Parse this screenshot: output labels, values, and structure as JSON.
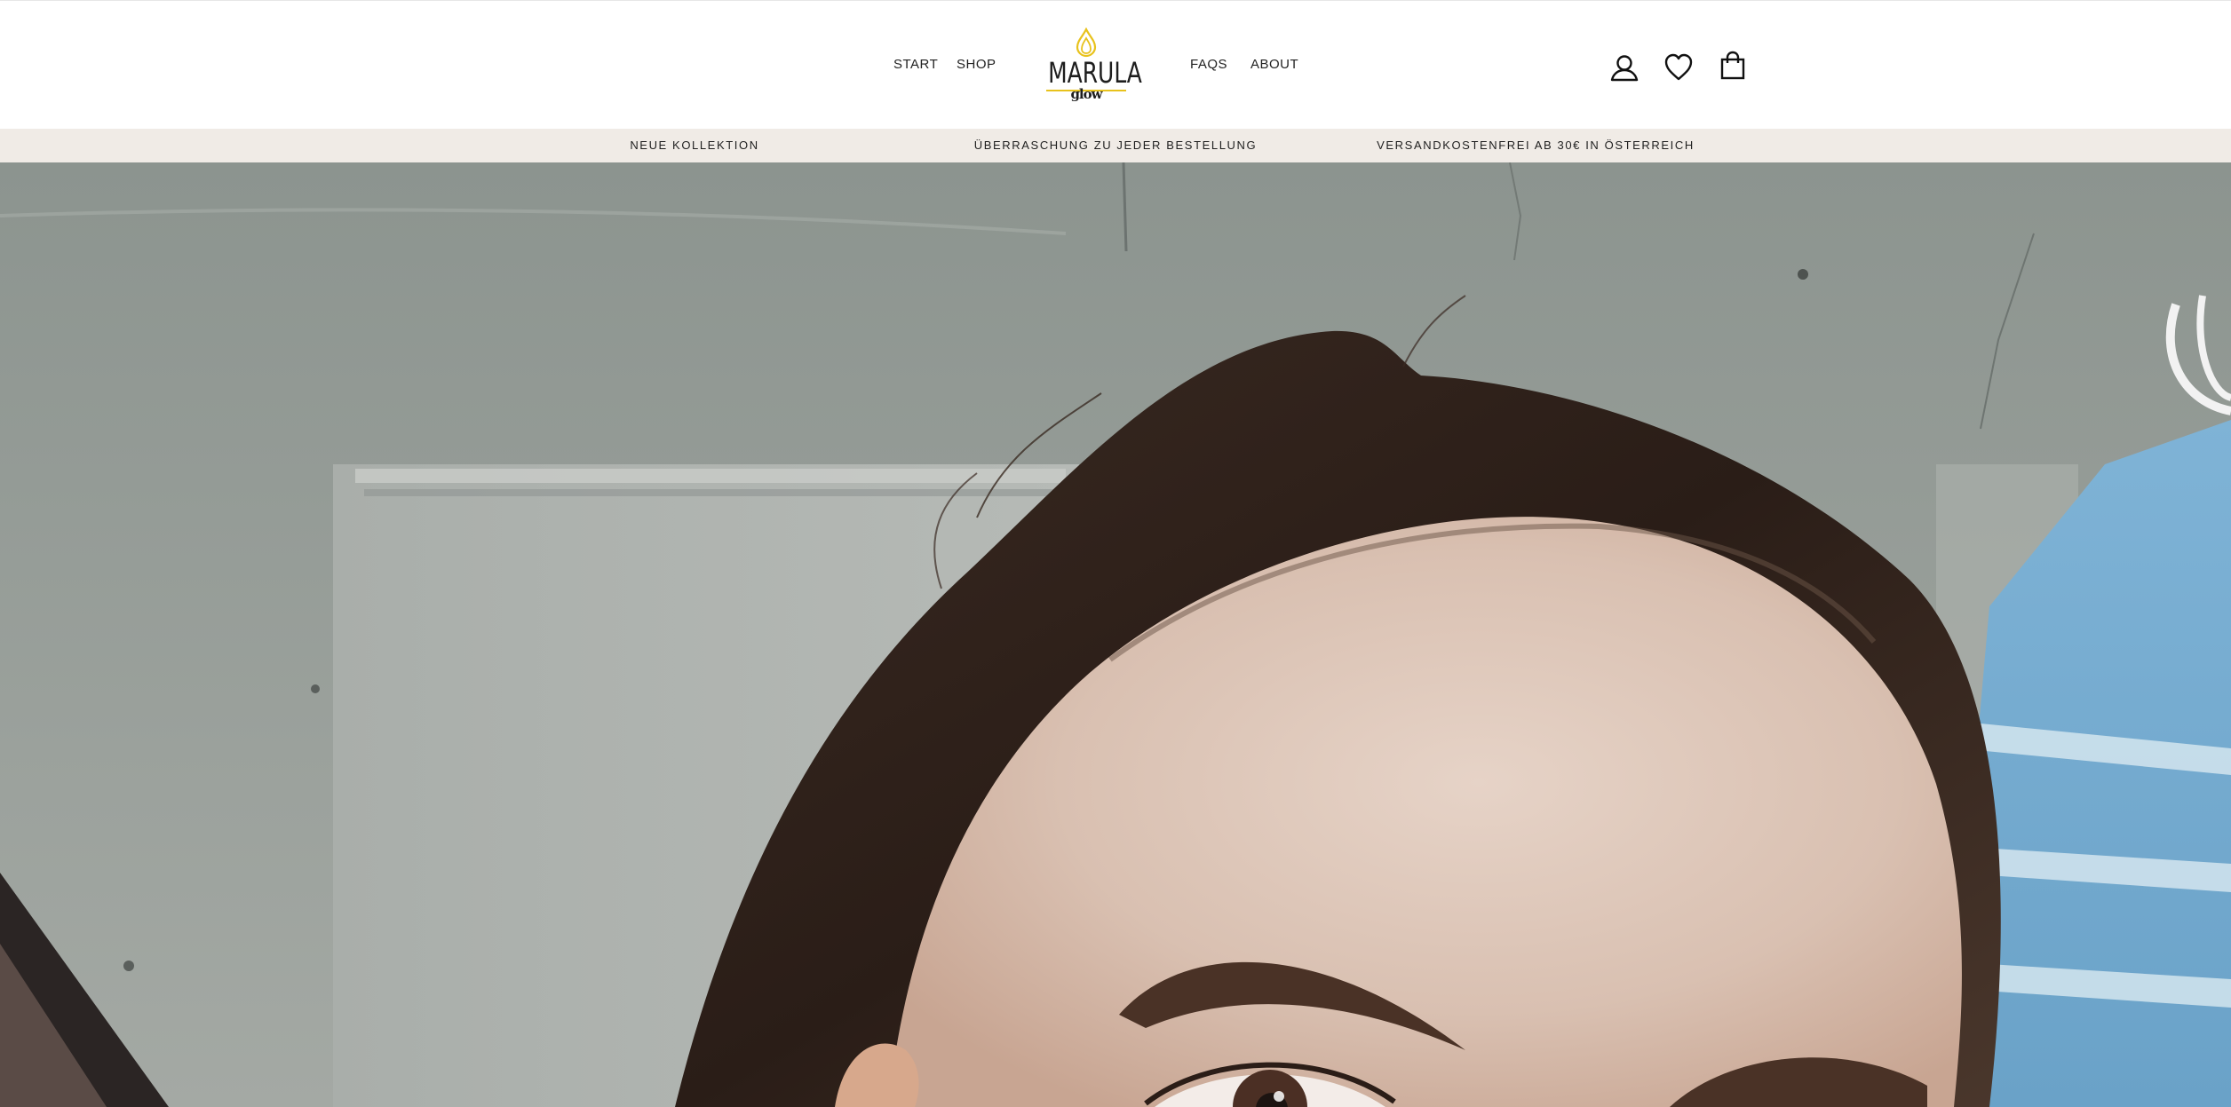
{
  "header": {
    "nav_left": [
      {
        "label": "START"
      },
      {
        "label": "SHOP"
      }
    ],
    "nav_right": [
      {
        "label": "FAQS"
      },
      {
        "label": "ABOUT"
      }
    ],
    "logo": {
      "wordmark": "MARULA",
      "subtext": "glow",
      "accent_color": "#e8c21c"
    },
    "icons": {
      "account": "account-icon",
      "wishlist": "heart-icon",
      "cart": "shopping-bag-icon"
    }
  },
  "announcement_bar": {
    "background": "#f0ebe6",
    "items": [
      {
        "text": "NEUE KOLLEKTION"
      },
      {
        "text": "ÜBERRASCHUNG ZU JEDER BESTELLUNG"
      },
      {
        "text": "VERSANDKOSTENFREI AB 30€ IN ÖSTERREICH"
      }
    ]
  },
  "hero": {
    "image_subject": "close-up portrait photo of a woman's face and brows"
  }
}
